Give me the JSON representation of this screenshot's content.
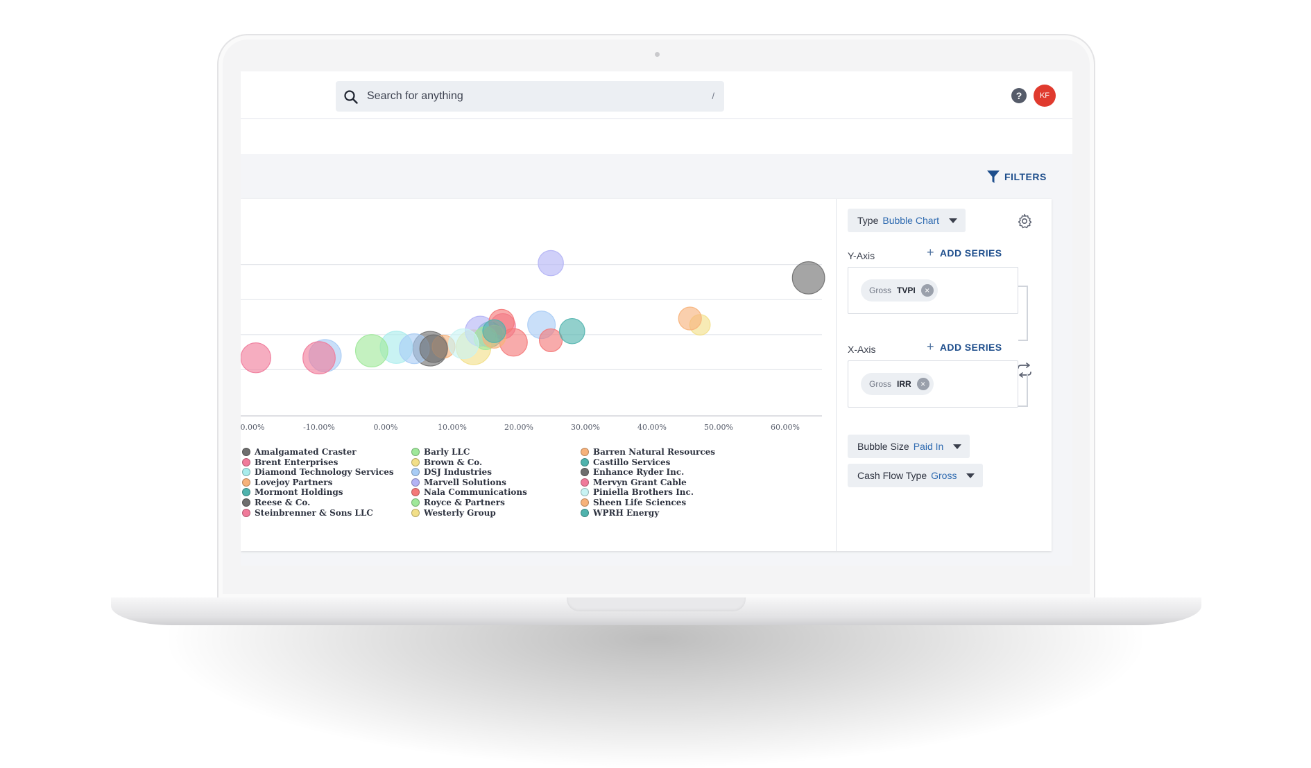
{
  "search": {
    "placeholder": "Search for anything",
    "shortcut": "/"
  },
  "header": {
    "help_label": "?",
    "avatar_initials": "KF"
  },
  "toolbar": {
    "filters_label": "FILTERS"
  },
  "panel": {
    "type": {
      "label": "Type",
      "value": "Bubble Chart"
    },
    "y_axis": {
      "label": "Y-Axis",
      "add_series": "ADD SERIES",
      "tag_kind": "Gross",
      "tag_metric": "TVPI"
    },
    "x_axis": {
      "label": "X-Axis",
      "add_series": "ADD SERIES",
      "tag_kind": "Gross",
      "tag_metric": "IRR"
    },
    "bubble_size": {
      "label": "Bubble Size",
      "value": "Paid In"
    },
    "cash_flow_type": {
      "label": "Cash Flow Type",
      "value": "Gross"
    }
  },
  "colors": {
    "accent": "#1e4e8c",
    "value_text": "#2e6ab0",
    "avatar": "#e03a2e"
  },
  "chart_data": {
    "type": "scatter",
    "variant": "bubble",
    "x_ticks": [
      "0.00%",
      "-10.00%",
      "0.00%",
      "10.00%",
      "20.00%",
      "30.00%",
      "40.00%",
      "50.00%",
      "60.00%"
    ],
    "xlim": [
      -21.5,
      64.5
    ],
    "ylim": [
      0.5,
      3.0
    ],
    "y_gridlines": [
      1.0,
      1.5,
      2.0,
      2.5
    ],
    "grid": true,
    "legend_position": "bottom",
    "series": [
      {
        "name": "Amalgamated Craster",
        "color": "#6e6e6e",
        "points": [
          [
            6.7,
            1.3,
            10
          ]
        ]
      },
      {
        "name": "Brent Enterprises",
        "color": "#f07a9a",
        "points": [
          [
            17.6,
            1.62,
            6
          ]
        ]
      },
      {
        "name": "Diamond Technology Services",
        "color": "#a8ecec",
        "points": [
          [
            1.6,
            1.32,
            9
          ]
        ]
      },
      {
        "name": "Lovejoy Partners",
        "color": "#f7b27a",
        "points": [
          [
            8.7,
            1.33,
            5
          ]
        ]
      },
      {
        "name": "Mormont Holdings",
        "color": "#4fb3ad",
        "points": [
          [
            15.6,
            1.5,
            6
          ]
        ]
      },
      {
        "name": "Reese & Co.",
        "color": "#6e6e6e",
        "points": [
          [
            63.5,
            2.31,
            9
          ]
        ]
      },
      {
        "name": "Steinbrenner & Sons LLC",
        "color": "#f07a9a",
        "points": [
          [
            -19.5,
            1.17,
            8
          ]
        ]
      },
      {
        "name": "Barly LLC",
        "color": "#9fe89a",
        "points": [
          [
            -2.1,
            1.27,
            9
          ]
        ]
      },
      {
        "name": "Brown & Co.",
        "color": "#f2df88",
        "points": [
          [
            13.2,
            1.32,
            10
          ]
        ]
      },
      {
        "name": "DSJ Industries",
        "color": "#a8ccf5",
        "points": [
          [
            -9.1,
            1.2,
            9
          ],
          [
            4.3,
            1.3,
            8
          ],
          [
            23.4,
            1.64,
            7
          ]
        ]
      },
      {
        "name": "Marvell Solutions",
        "color": "#b3b3f5",
        "points": [
          [
            24.8,
            2.52,
            6
          ],
          [
            14.2,
            1.55,
            8
          ]
        ]
      },
      {
        "name": "Nala Communications",
        "color": "#f47878",
        "points": [
          [
            17.4,
            1.68,
            6
          ],
          [
            19.2,
            1.39,
            7
          ],
          [
            24.8,
            1.42,
            5
          ]
        ]
      },
      {
        "name": "Royce & Partners",
        "color": "#9fe89a",
        "points": [
          [
            15.0,
            1.45,
            5
          ]
        ]
      },
      {
        "name": "Westerly Group",
        "color": "#f2df88",
        "points": [
          [
            47.2,
            1.64,
            4
          ]
        ]
      },
      {
        "name": "Barren Natural Resources",
        "color": "#f7b27a",
        "points": [
          [
            45.7,
            1.73,
            5
          ]
        ]
      },
      {
        "name": "Castillo Services",
        "color": "#4fb3ad",
        "points": [
          [
            28.0,
            1.55,
            6
          ]
        ]
      },
      {
        "name": "Enhance Ryder Inc.",
        "color": "#6e6e6e",
        "points": [
          [
            7.2,
            1.3,
            7
          ]
        ]
      },
      {
        "name": "Mervyn Grant Cable",
        "color": "#f07a9a",
        "points": [
          [
            -10.0,
            1.17,
            9
          ]
        ]
      },
      {
        "name": "Piniella Brothers Inc.",
        "color": "#c8f3f3",
        "points": [
          [
            11.7,
            1.37,
            8
          ]
        ]
      },
      {
        "name": "Sheen Life Sciences",
        "color": "#f7b27a",
        "points": [
          [
            16.3,
            1.47,
            5
          ]
        ]
      },
      {
        "name": "WPRH Energy",
        "color": "#4fb3ad",
        "points": [
          [
            16.3,
            1.55,
            5
          ]
        ]
      }
    ]
  }
}
